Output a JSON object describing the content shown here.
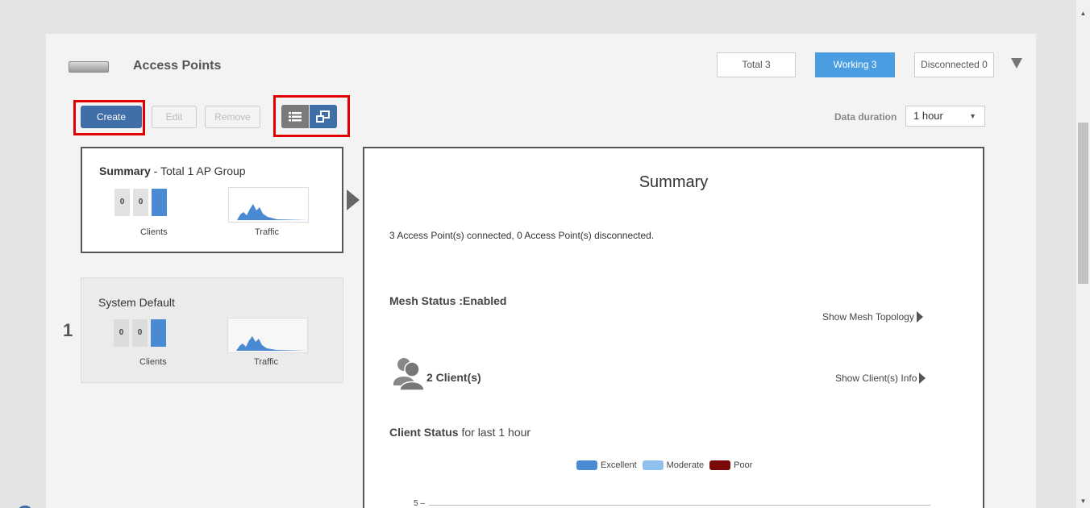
{
  "header": {
    "title": "Access Points",
    "stats": {
      "total": "Total 3",
      "working": "Working 3",
      "disconnected": "Disconnected 0"
    }
  },
  "toolbar": {
    "create_label": "Create",
    "edit_label": "Edit",
    "remove_label": "Remove",
    "data_duration_label": "Data duration",
    "data_duration_value": "1 hour"
  },
  "groups": {
    "summary": {
      "title_bold": "Summary",
      "title_rest": " - Total 1 AP Group",
      "counts": [
        "0",
        "0",
        "2"
      ],
      "clients_label": "Clients",
      "traffic_label": "Traffic"
    },
    "system_default": {
      "index": "1",
      "title": "System Default",
      "counts": [
        "0",
        "0",
        "2"
      ],
      "clients_label": "Clients",
      "traffic_label": "Traffic"
    }
  },
  "detail": {
    "title": "Summary",
    "connection_text": "3 Access Point(s) connected, 0 Access Point(s) disconnected.",
    "mesh_status": "Mesh Status :Enabled",
    "mesh_link": "Show Mesh Topology",
    "clients_count": "2 Client(s)",
    "clients_link": "Show Client(s) Info",
    "client_status_bold": "Client Status",
    "client_status_rest": " for last 1 hour",
    "legend": [
      {
        "label": "Excellent",
        "color": "#4a8ad3"
      },
      {
        "label": "Moderate",
        "color": "#8fc0ee"
      },
      {
        "label": "Poor",
        "color": "#7a0a0a"
      }
    ],
    "y_tick": "5"
  },
  "colors": {
    "accent": "#3f6ea8",
    "working": "#4a9de0",
    "highlight": "#e00000"
  },
  "icons": {
    "ap_device": "access-point-device-icon",
    "list_view": "list-view-icon",
    "group_view": "group-view-icon",
    "collapse": "collapse-triangle-icon",
    "users": "users-icon"
  }
}
